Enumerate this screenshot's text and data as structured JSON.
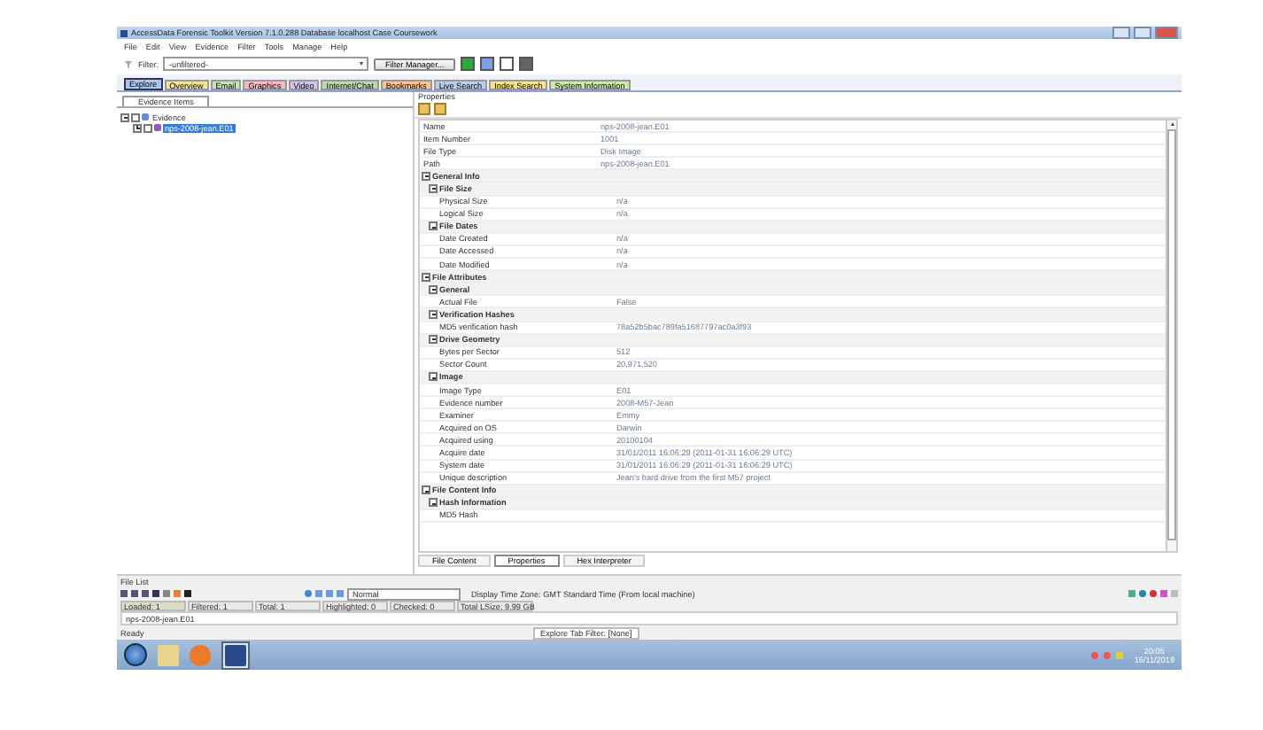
{
  "window": {
    "title": "AccessData Forensic Toolkit Version 7.1.0.288 Database localhost Case Coursework"
  },
  "menu": [
    "File",
    "Edit",
    "View",
    "Evidence",
    "Filter",
    "Tools",
    "Manage",
    "Help"
  ],
  "toolbar": {
    "filter_label": "Filter:",
    "filter_value": "-unfiltered-",
    "filter_manager": "Filter Manager..."
  },
  "tabs": [
    {
      "label": "Explore",
      "selected": true,
      "color": "#a9c6ec"
    },
    {
      "label": "Overview",
      "selected": false,
      "color": "#f4e29a"
    },
    {
      "label": "Email",
      "selected": false,
      "color": "#c7e3b5"
    },
    {
      "label": "Graphics",
      "selected": false,
      "color": "#f3b8c4"
    },
    {
      "label": "Video",
      "selected": false,
      "color": "#d0c4ec"
    },
    {
      "label": "Internet/Chat",
      "selected": false,
      "color": "#b9d8b0"
    },
    {
      "label": "Bookmarks",
      "selected": false,
      "color": "#f5c39b"
    },
    {
      "label": "Live Search",
      "selected": false,
      "color": "#b8cff0"
    },
    {
      "label": "Index Search",
      "selected": false,
      "color": "#f5e38e"
    },
    {
      "label": "System Information",
      "selected": false,
      "color": "#cfe6b0"
    }
  ],
  "evidence_panel": {
    "tab": "Evidence Items",
    "tree": [
      {
        "label": "Evidence",
        "expanded": true,
        "checked": false,
        "selected": false,
        "children": [
          {
            "label": "nps-2008-jean.E01",
            "expanded": false,
            "checked": false,
            "selected": true
          }
        ]
      }
    ]
  },
  "properties": {
    "title": "Properties",
    "rows": [
      {
        "name": "Name",
        "value": "nps-2008-jean.E01"
      },
      {
        "name": "Item Number",
        "value": "1001"
      },
      {
        "name": "File Type",
        "value": "Disk Image"
      },
      {
        "name": "Path",
        "value": "nps-2008-jean.E01"
      }
    ],
    "sections": [
      {
        "title": "General Info",
        "expanded": true,
        "children": [
          {
            "title": "File Size",
            "expanded": true,
            "rows": [
              {
                "name": "Physical Size",
                "value": "n/a"
              },
              {
                "name": "Logical Size",
                "value": "n/a"
              }
            ]
          },
          {
            "title": "File Dates",
            "expanded": true,
            "rows": [
              {
                "name": "Date Created",
                "value": "n/a"
              },
              {
                "name": "Date Accessed",
                "value": "n/a"
              },
              {
                "name": "Date Modified",
                "value": "n/a"
              }
            ]
          }
        ]
      },
      {
        "title": "File Attributes",
        "expanded": true,
        "children": [
          {
            "title": "General",
            "expanded": true,
            "rows": [
              {
                "name": "Actual File",
                "value": "False"
              }
            ]
          },
          {
            "title": "Verification Hashes",
            "expanded": true,
            "rows": [
              {
                "name": "MD5 verification hash",
                "value": "78a52b5bac789fa51687797ac0a3f93"
              }
            ]
          },
          {
            "title": "Drive Geometry",
            "expanded": true,
            "rows": [
              {
                "name": "Bytes per Sector",
                "value": "512"
              },
              {
                "name": "Sector Count",
                "value": "20,971,520"
              }
            ]
          },
          {
            "title": "Image",
            "expanded": true,
            "rows": [
              {
                "name": "Image Type",
                "value": "E01"
              },
              {
                "name": "Evidence number",
                "value": "2008-M57-Jean"
              },
              {
                "name": "Examiner",
                "value": "Emmy"
              },
              {
                "name": "Acquired on OS",
                "value": "Darwin"
              },
              {
                "name": "Acquired using",
                "value": "20100104"
              },
              {
                "name": "Acquire date",
                "value": "31/01/2011 16:06:29 (2011-01-31 16:06:29 UTC)"
              },
              {
                "name": "System date",
                "value": "31/01/2011 16:06:29 (2011-01-31 16:06:29 UTC)"
              },
              {
                "name": "Unique description",
                "value": "Jean's hard drive from the first M57 project"
              }
            ]
          }
        ]
      },
      {
        "title": "File Content Info",
        "expanded": true,
        "children": [
          {
            "title": "Hash Information",
            "expanded": true,
            "rows": [
              {
                "name": "MD5 Hash"
              }
            ]
          }
        ]
      }
    ]
  },
  "bottom_tabs": [
    {
      "label": "File Content",
      "selected": false
    },
    {
      "label": "Properties",
      "selected": true
    },
    {
      "label": "Hex Interpreter",
      "selected": false
    }
  ],
  "file_list": {
    "title": "File List",
    "view": "Normal",
    "time_zone": "Display Time Zone: GMT Standard Time  (From local machine)",
    "counts": [
      "Loaded: 1",
      "Filtered: 1",
      "Total: 1",
      "Highlighted: 0",
      "Checked: 0",
      "Total LSize: 9.99 GB"
    ],
    "path": "nps-2008-jean.E01"
  },
  "status_bar": {
    "left": "Ready",
    "center": "Explore Tab Filter: [None]"
  },
  "taskbar": {
    "time": "20:05",
    "date": "16/11/2019"
  }
}
